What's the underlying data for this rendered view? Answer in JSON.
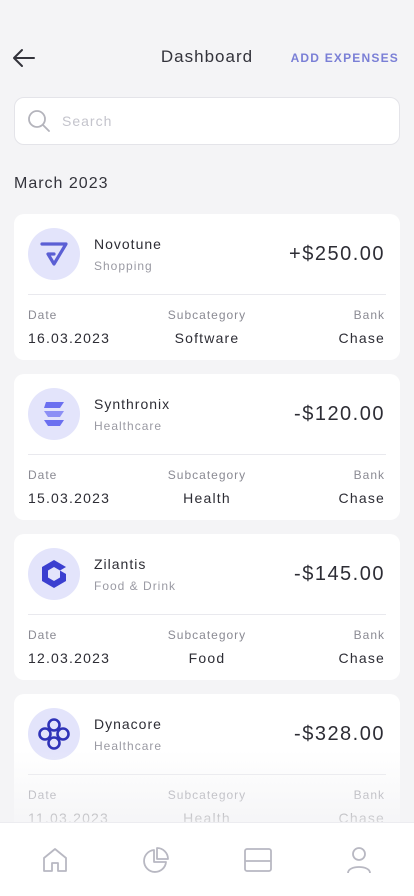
{
  "header": {
    "title": "Dashboard",
    "action_label": "ADD EXPENSES"
  },
  "search": {
    "placeholder": "Search",
    "value": ""
  },
  "section": {
    "title": "March 2023"
  },
  "labels": {
    "date": "Date",
    "subcategory": "Subcategory",
    "bank": "Bank"
  },
  "transactions": [
    {
      "merchant": "Novotune",
      "category": "Shopping",
      "amount": "+$250.00",
      "date": "16.03.2023",
      "subcategory": "Software",
      "bank": "Chase",
      "icon": "novotune-logo-icon"
    },
    {
      "merchant": "Synthronix",
      "category": "Healthcare",
      "amount": "-$120.00",
      "date": "15.03.2023",
      "subcategory": "Health",
      "bank": "Chase",
      "icon": "synthronix-logo-icon"
    },
    {
      "merchant": "Zilantis",
      "category": "Food & Drink",
      "amount": "-$145.00",
      "date": "12.03.2023",
      "subcategory": "Food",
      "bank": "Chase",
      "icon": "zilantis-logo-icon"
    },
    {
      "merchant": "Dynacore",
      "category": "Healthcare",
      "amount": "-$328.00",
      "date": "11.03.2023",
      "subcategory": "Health",
      "bank": "Chase",
      "icon": "dynacore-logo-icon"
    }
  ],
  "tabbar": {
    "items": [
      "home-icon",
      "pie-chart-icon",
      "card-icon",
      "profile-icon"
    ]
  },
  "colors": {
    "accent": "#7a7fd6",
    "background": "#f4f4f6",
    "card": "#ffffff",
    "logo_bg": "#e3e4fb"
  }
}
